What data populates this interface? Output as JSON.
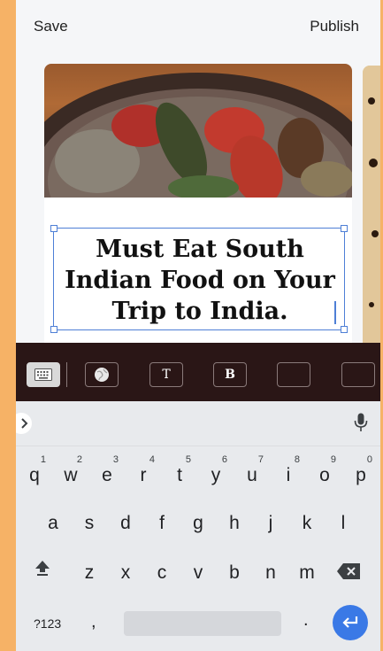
{
  "header": {
    "save_label": "Save",
    "publish_label": "Publish"
  },
  "story": {
    "title": "Must Eat South Indian Food on Your Trip to India."
  },
  "format_toolbar": {
    "items": [
      "keyboard-icon",
      "globe-icon",
      "text-style-icon",
      "bold-icon",
      "empty-slot",
      "empty-slot"
    ],
    "text_label": "T",
    "bold_label": "B"
  },
  "keyboard": {
    "row1": [
      "q",
      "w",
      "e",
      "r",
      "t",
      "y",
      "u",
      "i",
      "o",
      "p"
    ],
    "row1_hints": [
      "1",
      "2",
      "3",
      "4",
      "5",
      "6",
      "7",
      "8",
      "9",
      "0"
    ],
    "row2": [
      "a",
      "s",
      "d",
      "f",
      "g",
      "h",
      "j",
      "k",
      "l"
    ],
    "row3": [
      "z",
      "x",
      "c",
      "v",
      "b",
      "n",
      "m"
    ],
    "symbols_label": "?123",
    "comma": ",",
    "period": "."
  },
  "colors": {
    "page_background": "#F6B266",
    "accent": "#4E7FD6",
    "enter_key": "#3A79E6",
    "toolbar": "#2A1616",
    "keyboard": "#E8EAED"
  }
}
